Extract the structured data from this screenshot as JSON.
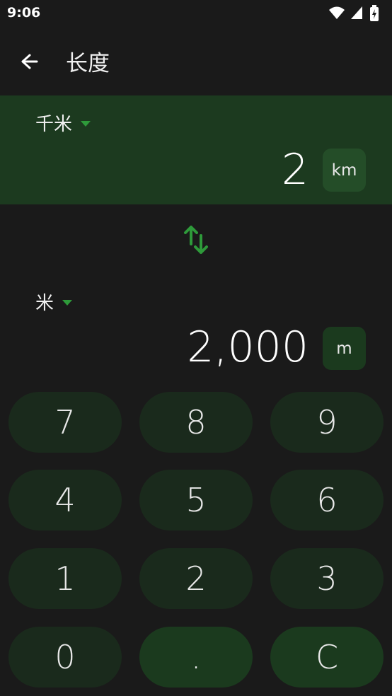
{
  "status_bar": {
    "time": "9:06"
  },
  "app_bar": {
    "title": "长度"
  },
  "converter": {
    "from": {
      "unit_name": "千米",
      "value": "2",
      "unit_symbol": "km"
    },
    "to": {
      "unit_name": "米",
      "value": "2,000",
      "unit_symbol": "m"
    }
  },
  "keypad": {
    "keys": [
      "7",
      "8",
      "9",
      "4",
      "5",
      "6",
      "1",
      "2",
      "3",
      "0",
      ".",
      "C"
    ]
  }
}
